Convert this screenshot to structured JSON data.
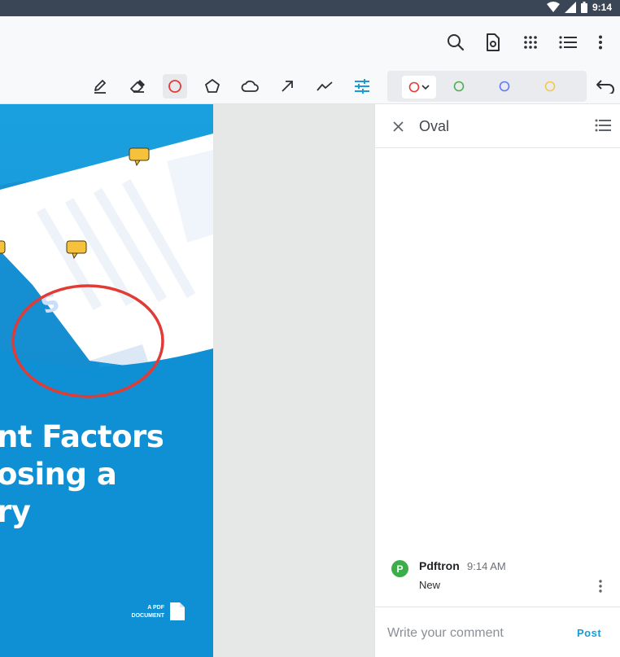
{
  "status_bar": {
    "time": "9:14"
  },
  "app_bar": {
    "icons": [
      "search-icon",
      "page-settings-icon",
      "grid-icon",
      "list-icon",
      "more-vert-icon"
    ]
  },
  "toolbar": {
    "tools": [
      "pen-icon",
      "eraser-icon",
      "oval-icon",
      "polygon-icon",
      "cloud-icon",
      "arrow-icon",
      "freehand-line-icon",
      "style-settings-icon"
    ],
    "active_tool": "oval",
    "colors": {
      "red": "#e53935",
      "green": "#4caf50",
      "blue": "#5c7cf7",
      "yellow": "#f3c94e",
      "accent": "#1a9ad6"
    }
  },
  "document": {
    "title_lines": [
      "nt Factors",
      "osing a",
      "ry"
    ],
    "label_line1": "A PDF",
    "label_line2": "DOCUMENT"
  },
  "panel": {
    "title": "Oval",
    "comment": {
      "avatar_letter": "P",
      "author": "Pdftron",
      "time": "9:14 AM",
      "text": "New"
    },
    "compose_placeholder": "Write your comment",
    "post_label": "Post"
  }
}
